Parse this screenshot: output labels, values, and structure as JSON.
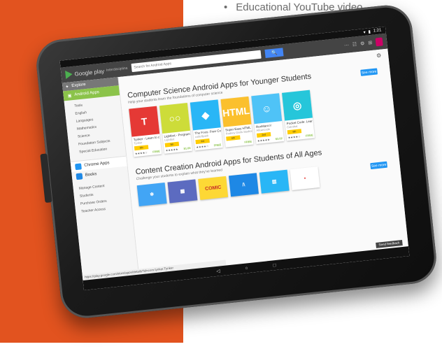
{
  "background": {
    "left_color": "#e2531f",
    "right_color": "#ffffff"
  },
  "top_bullet": {
    "bullet": "•",
    "text": "Educational YouTube video"
  },
  "play_store": {
    "status_icons": [
      "wifi-icon",
      "battery-icon"
    ],
    "status_time": "1:21",
    "logo_text": "Google play",
    "logo_sub": "Interdisciplina",
    "search_placeholder": "Search for Android Apps",
    "search_icon": "🔍",
    "header_icons": [
      "⋯",
      "☷",
      "⚙",
      "⊞"
    ],
    "sidebar": {
      "explore": "Explore",
      "android_apps": "Android Apps",
      "categories": [
        "Tools",
        "English",
        "Languages",
        "Mathematics",
        "Science",
        "Foundation Subjects",
        "Special Education"
      ],
      "chrome_apps": "Chrome Apps",
      "books": "Books",
      "bottom_items": [
        "Manage Content",
        "Students",
        "Purchase Orders",
        "Teacher Access"
      ]
    },
    "section1": {
      "title": "Computer Science Android Apps for Younger Students",
      "subtitle": "Help your students learn the foundations of computer science",
      "see_more": "See more",
      "apps": [
        {
          "name": "Tynker - Learn to c",
          "dev": "Tynker",
          "badge": "5th",
          "stars": "★★★★☆",
          "price": "FREE",
          "art": "T",
          "color": "#e53935"
        },
        {
          "name": "Lightbot - Program",
          "dev": "Lightbot",
          "badge": "5th",
          "stars": "★★★★★",
          "price": "$1.66",
          "art": "○○",
          "color": "#cddc39"
        },
        {
          "name": "The Foos: Free Co",
          "dev": "codeSpark",
          "badge": "3rd",
          "stars": "★★★★☆",
          "price": "FREE",
          "art": "◆",
          "color": "#29b6f6"
        },
        {
          "name": "Super Easy HTML",
          "dev": "Rodney Darts Studios",
          "badge": "6th",
          "stars": "",
          "price": "FREE",
          "art": "<HTML>",
          "color": "#fbc02d"
        },
        {
          "name": "RunMarco!",
          "dev": "Allcancode",
          "badge": "2nd",
          "stars": "★★★★★",
          "price": "$3.62",
          "art": "☺",
          "color": "#4fc3f7"
        },
        {
          "name": "Pocket Code: Lear",
          "dev": "Catrobat",
          "badge": "6th",
          "stars": "★★★★☆",
          "price": "FREE",
          "art": "◎",
          "color": "#26c6da"
        }
      ]
    },
    "section2": {
      "title": "Content Creation Android Apps for Students of All Ages",
      "subtitle": "Challenge your students to explain what they've learned",
      "see_more": "See more",
      "apps": [
        {
          "art": "❄",
          "color": "#42a5f5"
        },
        {
          "art": "▦",
          "color": "#5c6bc0"
        },
        {
          "art": "COMIC",
          "color": "#fdd835"
        },
        {
          "art": "/\\",
          "color": "#1e88e5"
        },
        {
          "art": "▥",
          "color": "#29b6f6"
        },
        {
          "art": "•",
          "color": "#ffffff"
        }
      ]
    },
    "url": "https://play.google.com/store/apps/details?id=com.tynker.Tynker",
    "send_feedback": "Send feedback",
    "nav": {
      "back": "◁",
      "home": "○",
      "recent": "□"
    }
  }
}
